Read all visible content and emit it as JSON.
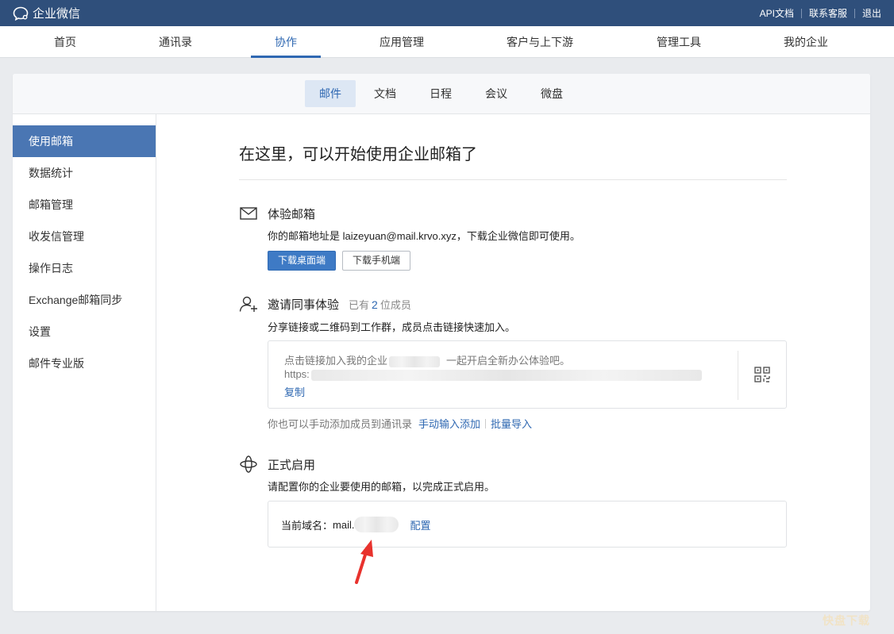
{
  "topbar": {
    "brand": "企业微信",
    "links": [
      "API文档",
      "联系客服",
      "退出"
    ]
  },
  "nav": {
    "items": [
      "首页",
      "通讯录",
      "协作",
      "应用管理",
      "客户与上下游",
      "管理工具",
      "我的企业"
    ],
    "active": "协作"
  },
  "subnav": {
    "items": [
      "邮件",
      "文档",
      "日程",
      "会议",
      "微盘"
    ],
    "active": "邮件"
  },
  "sidebar": {
    "items": [
      "使用邮箱",
      "数据统计",
      "邮箱管理",
      "收发信管理",
      "操作日志",
      "Exchange邮箱同步",
      "设置",
      "邮件专业版"
    ],
    "active": "使用邮箱"
  },
  "main": {
    "title": "在这里，可以开始使用企业邮箱了",
    "trial": {
      "title": "体验邮箱",
      "desc": "你的邮箱地址是 laizeyuan@mail.krvo.xyz，下载企业微信即可使用。",
      "btn_desktop": "下载桌面端",
      "btn_mobile": "下载手机端"
    },
    "invite": {
      "title": "邀请同事体验",
      "count_prefix": "已有",
      "count": "2",
      "count_suffix": "位成员",
      "desc": "分享链接或二维码到工作群，成员点击链接快速加入。",
      "link_text_prefix": "点击链接加入我的企业",
      "link_text_suffix": "一起开启全新办公体验吧。",
      "link_url_prefix": "https:",
      "copy": "复制",
      "manual_text": "你也可以手动添加成员到通讯录",
      "manual_add": "手动输入添加",
      "batch_import": "批量导入"
    },
    "formal": {
      "title": "正式启用",
      "desc": "请配置你的企业要使用的邮箱，以完成正式启用。",
      "domain_label": "当前域名：",
      "domain_value": "mail.",
      "configure": "配置"
    }
  },
  "watermark": "快盘下载",
  "icons": {
    "brand": "chat-bubble-icon",
    "mail": "envelope-icon",
    "invite": "add-person-icon",
    "formal": "sparkle-icon",
    "qr": "qr-code-icon"
  },
  "colors": {
    "topbar": "#2f4f7b",
    "accent": "#2f68b2",
    "sidebar_active": "#4a76b3",
    "primary_button": "#3e7ac5",
    "arrow": "#e8322d"
  }
}
